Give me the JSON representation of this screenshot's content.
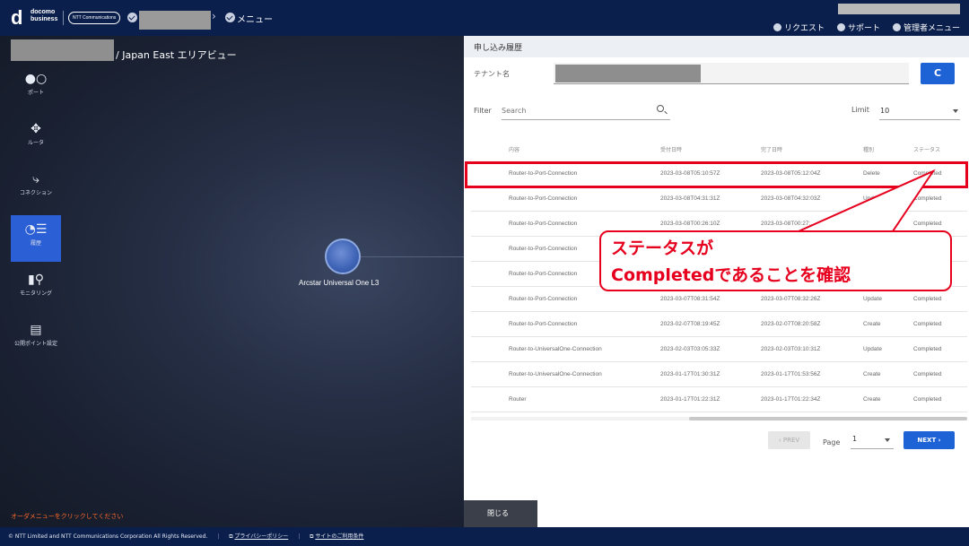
{
  "header": {
    "logo_brand": "d",
    "logo_line1": "docomo",
    "logo_line2": "business",
    "ntt_logo": "NTT Communications",
    "crumb_menu": "メニュー",
    "links": [
      "リクエスト",
      "サポート",
      "管理者メニュー"
    ]
  },
  "map": {
    "area_title": "/ Japan East エリアビュー",
    "node_label": "Arcstar Universal One L3",
    "bottom_note": "オーダメニューをクリックしてください"
  },
  "sidebar": {
    "items": [
      {
        "label": "ポート",
        "icon": "port-icon"
      },
      {
        "label": "ルータ",
        "icon": "router-icon"
      },
      {
        "label": "コネクション",
        "icon": "connection-icon"
      },
      {
        "label": "履歴",
        "icon": "history-icon",
        "active": true
      },
      {
        "label": "モニタリング",
        "icon": "monitoring-icon"
      },
      {
        "label": "公開ポイント設定",
        "icon": "public-point-icon"
      }
    ]
  },
  "panel": {
    "title": "申し込み履歴",
    "tenant_label": "テナント名",
    "refresh_label": "C",
    "filter_label": "Filter",
    "search_placeholder": "Search",
    "limit_label": "Limit",
    "limit_value": "10",
    "columns": [
      "内容",
      "受付日時",
      "完了日時",
      "種別",
      "ステータス"
    ],
    "rows": [
      [
        "Router-to-Port-Connection",
        "2023-03-08T05:10:57Z",
        "2023-03-08T05:12:04Z",
        "Delete",
        "Completed"
      ],
      [
        "Router-to-Port-Connection",
        "2023-03-08T04:31:31Z",
        "2023-03-08T04:32:03Z",
        "Update",
        "Completed"
      ],
      [
        "Router-to-Port-Connection",
        "2023-03-08T00:26:10Z",
        "2023-03-08T00:27:...",
        "",
        "Completed"
      ],
      [
        "Router-to-Port-Connection",
        "",
        "",
        "",
        ""
      ],
      [
        "Router-to-Port-Connection",
        "",
        "",
        "",
        ""
      ],
      [
        "Router-to-Port-Connection",
        "2023-03-07T08:31:54Z",
        "2023-03-07T08:32:26Z",
        "Update",
        "Completed"
      ],
      [
        "Router-to-Port-Connection",
        "2023-02-07T08:19:45Z",
        "2023-02-07T08:20:58Z",
        "Create",
        "Completed"
      ],
      [
        "Router-to-UniversalOne-Connection",
        "2023-02-03T03:05:33Z",
        "2023-02-03T03:10:31Z",
        "Update",
        "Completed"
      ],
      [
        "Router-to-UniversalOne-Connection",
        "2023-01-17T01:30:31Z",
        "2023-01-17T01:53:56Z",
        "Create",
        "Completed"
      ],
      [
        "Router",
        "2023-01-17T01:22:31Z",
        "2023-01-17T01:22:34Z",
        "Create",
        "Completed"
      ]
    ],
    "prev_label": "‹  PREV",
    "page_label": "Page",
    "page_value": "1",
    "next_label": "NEXT  ›",
    "close_label": "閉じる"
  },
  "annotation": {
    "line1": "ステータスが",
    "line2": "Completedであることを確認",
    "color": "#e6001e"
  },
  "footer": {
    "copyright": "© NTT Limited and NTT Communications Corporation All Rights Reserved.",
    "privacy": "プライバシーポリシー",
    "terms": "サイトのご利用条件"
  },
  "colors": {
    "header_bg": "#0b1f4d",
    "accent": "#1e63d6",
    "highlight": "#e6001e",
    "warning_text": "#ff6a2a"
  }
}
